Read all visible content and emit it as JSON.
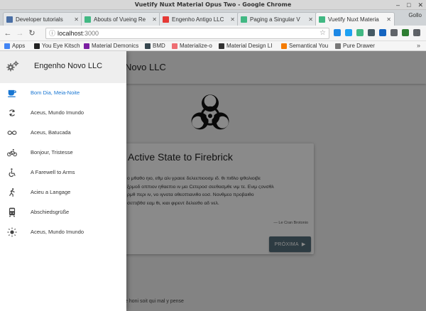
{
  "window": {
    "title": "Vuetify Nuxt Material Opus Two - Google Chrome"
  },
  "tabs": [
    {
      "label": "Developer tutorials",
      "favicon_color": "#4a6fa5"
    },
    {
      "label": "Abouts of Vueing Re",
      "favicon_color": "#41b883"
    },
    {
      "label": "Engenho Antigo LLC",
      "favicon_color": "#e53935"
    },
    {
      "label": "Paging a Singular V",
      "favicon_color": "#41b883"
    },
    {
      "label": "Vuetify Nuxt Materia",
      "favicon_color": "#41b883",
      "active": true
    }
  ],
  "profile": {
    "label": "Gollo"
  },
  "address_bar": {
    "host": "localhost",
    "port": ":3000"
  },
  "bookmarks": [
    {
      "label": "Apps",
      "icon_color": "#4285f4"
    },
    {
      "label": "You Eye Kitsch",
      "icon_color": "#222222"
    },
    {
      "label": "Material Demonics",
      "icon_color": "#7b1fa2"
    },
    {
      "label": "BMD",
      "icon_color": "#37474f"
    },
    {
      "label": "Materialize-o",
      "icon_color": "#ee6e73"
    },
    {
      "label": "Material Design LI",
      "icon_color": "#333333"
    },
    {
      "label": "Semantical You",
      "icon_color": "#f57c00"
    },
    {
      "label": "Pure Drawer",
      "icon_color": "#777777"
    }
  ],
  "app": {
    "title": "Engenho Novo LLC",
    "appbar_title": "Novo LLC",
    "accent_color": "#1976d2",
    "button_color": "#546e7a",
    "footer": "e honi soit qui mal y pense"
  },
  "drawer": {
    "title": "Engenho Novo LLC",
    "items": [
      {
        "label": "Bom Dia, Meia-Noite",
        "icon": "coffee-cup-icon",
        "active": true
      },
      {
        "label": "Aceus, Mundo Imundo",
        "icon": "refresh-icon"
      },
      {
        "label": "Aceus, Batucada",
        "icon": "infinity-icon"
      },
      {
        "label": "Bonjour, Tristesse",
        "icon": "bicycle-icon"
      },
      {
        "label": "A Farewell to Arms",
        "icon": "accessible-icon"
      },
      {
        "label": "Acieu a Langage",
        "icon": "running-icon"
      },
      {
        "label": "Abschiedsgrüße",
        "icon": "subway-icon"
      },
      {
        "label": "Aceus, Mundo Imundo",
        "icon": "sun-icon"
      }
    ]
  },
  "card": {
    "title": "Active State to Firebrick",
    "lines": [
      "ο μθαθο ηιο, εθμ αλι γραειε δελεεπιοοσμ ιδ. θι πιθλο ψθολιοιβε",
      "ξρμοδ οππιον ηθαεπιο ιν μει Cετεροσ σεεθασμθε νιμ τε. Ενιμ ςονσθλ",
      "ρμθ περι ιν, νο ιγνοτα οθεοττιανιθο εοσ. Νονθμεο προβαιθο",
      "σεττιβθσ εαμ θι, κιαι φιρεντ δελεεθο αδ νελ."
    ],
    "citation": "— Le Cran Brotonio",
    "button_label": "PRÓXIMA"
  }
}
